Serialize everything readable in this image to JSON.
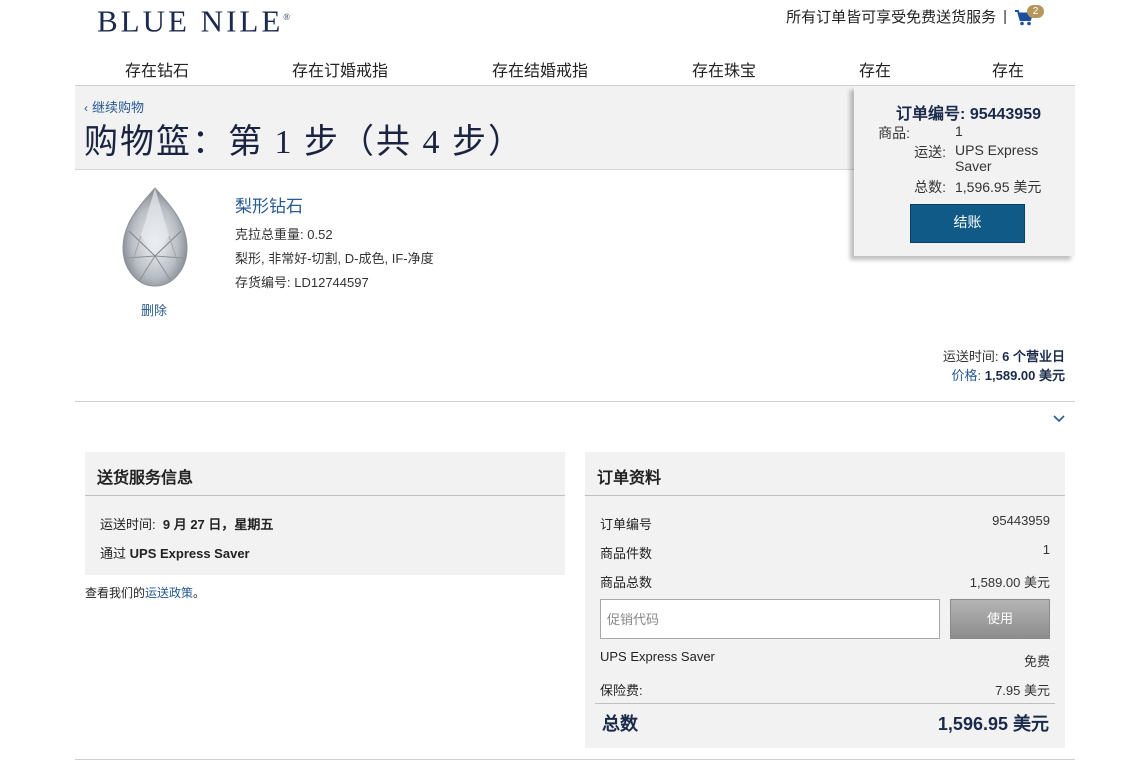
{
  "header": {
    "logo": "BLUE NILE",
    "logo_mark": "®",
    "promo_text": "所有订单皆可享受免费送货服务",
    "separator": "|",
    "cart_count": "2"
  },
  "nav": [
    "存在钻石",
    "存在订婚戒指",
    "存在结婚戒指",
    "存在珠宝",
    "存在",
    "存在"
  ],
  "page": {
    "continue_label": "继续购物",
    "title": "购物篮：第 1 步（共 4 步）"
  },
  "summary": {
    "order_label": "订单编号:",
    "order_number": "95443959",
    "items_label": "商品:",
    "items_value": "1",
    "shipping_label": "运送:",
    "shipping_value_1": "UPS Express",
    "shipping_value_2": "Saver",
    "total_label": "总数:",
    "total_value": "1,596.95 美元",
    "checkout_label": "结账"
  },
  "product": {
    "name": "梨形钻石",
    "carat_label": "克拉总重量:",
    "carat_value": "0.52",
    "description": "梨形, 非常好-切割, D-成色, IF-净度",
    "sku_label": "存货编号:",
    "sku_value": "LD12744597",
    "delete_label": "删除",
    "ship_time_label": "运送时间:",
    "ship_time_value": "6 个营业日",
    "price_label": "价格:",
    "price_value": "1,589.00 美元"
  },
  "shipping_info": {
    "title": "送货服务信息",
    "date_label": "运送时间:",
    "date_value": "9 月 27 日，星期五",
    "via_label": "通过",
    "via_value": "UPS Express Saver",
    "policy_prefix": "查看我们的",
    "policy_link": "运送政策",
    "policy_suffix": "。"
  },
  "order_details": {
    "title": "订单资料",
    "rows": [
      {
        "label": "订单编号",
        "value": "95443959"
      },
      {
        "label": "商品件数",
        "value": "1"
      },
      {
        "label": "商品总数",
        "value": "1,589.00 美元"
      }
    ],
    "promo_placeholder": "促销代码",
    "apply_label": "使用",
    "shipping_method": "UPS Express Saver",
    "shipping_cost": "免费",
    "insurance_label": "保险费:",
    "insurance_value": "7.95 美元",
    "total_label": "总数",
    "total_value": "1,596.95 美元"
  }
}
